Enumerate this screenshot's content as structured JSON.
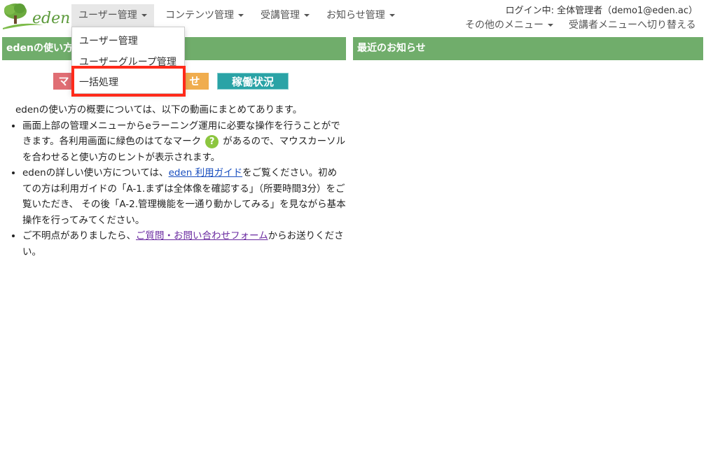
{
  "header": {
    "logo_text": "eden",
    "nav": [
      {
        "label": "ユーザー管理"
      },
      {
        "label": "コンテンツ管理"
      },
      {
        "label": "受講管理"
      },
      {
        "label": "お知らせ管理"
      }
    ],
    "login_info": "ログイン中: 全体管理者（demo1@eden.ac）",
    "other_menu": "その他のメニュー",
    "switch_menu": "受講者メニューへ切り替える"
  },
  "dropdown": {
    "items": [
      {
        "label": "ユーザー管理"
      },
      {
        "label": "ユーザーグループ管理"
      },
      {
        "label": "一括処理"
      }
    ]
  },
  "left_panel": {
    "title": "edenの使い方",
    "tiles": [
      "マ",
      "せ",
      "稼働状況"
    ],
    "intro": "edenの使い方の概要については、以下の動画にまとめてあります。",
    "bullet1_before": "画面上部の管理メニューからeラーニング運用に必要な操作を行うことができます。各利用画面に緑色のはてなマーク",
    "help_glyph": "?",
    "bullet1_after": "があるので、マウスカーソルを合わせると使い方のヒントが表示されます。",
    "bullet2_before": "edenの詳しい使い方については、",
    "bullet2_link": "eden 利用ガイド",
    "bullet2_after": "をご覧ください。初めての方は利用ガイドの「A-1.まずは全体像を確認する」（所要時間3分）をご覧いただき、 その後「A-2.管理機能を一通り動かしてみる」を見ながら基本操作を行ってみてください。",
    "bullet3_before": "ご不明点がありましたら、",
    "bullet3_link": "ご質問・お問い合わせフォーム",
    "bullet3_after": "からお送りください。"
  },
  "right_panel": {
    "title": "最近のお知らせ"
  },
  "colors": {
    "panel_header": "#70ad6b",
    "highlight_border": "#ff2a1a",
    "help_mark": "#8cc63f"
  }
}
